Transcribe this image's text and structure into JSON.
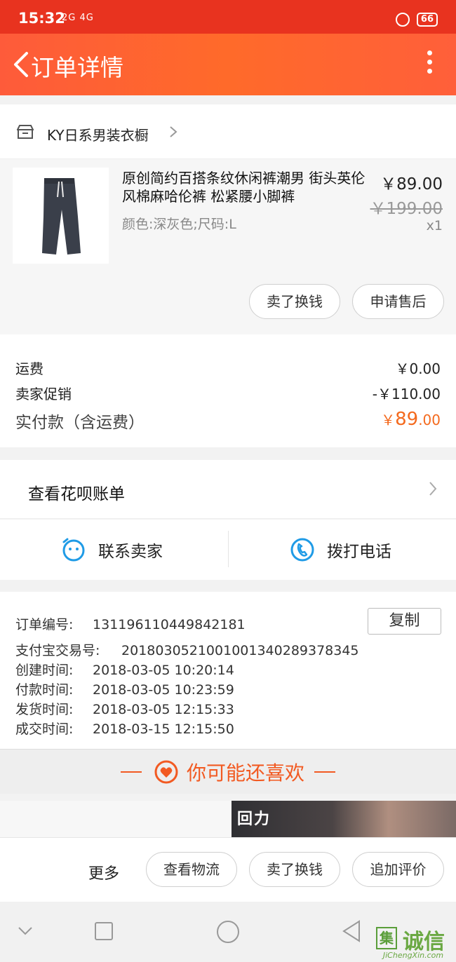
{
  "status_bar": {
    "time": "15:32",
    "signal": "2G 4G",
    "battery": "66"
  },
  "header": {
    "title": "订单详情"
  },
  "shop": {
    "name": "KY日系男装衣橱"
  },
  "item": {
    "title": "原创简约百搭条纹休闲裤潮男 街头英伦风棉麻哈伦裤 松紧腰小脚裤",
    "spec": "颜色:深灰色;尺码:L",
    "price": "￥89.00",
    "original_price": "￥199.00",
    "quantity": "x1",
    "buttons": [
      "卖了换钱",
      "申请售后"
    ]
  },
  "fees": {
    "shipping_label": "运费",
    "shipping_value": "￥0.00",
    "promo_label": "卖家促销",
    "promo_value": "-￥110.00",
    "total_label": "实付款（含运费）",
    "total_currency": "￥",
    "total_int": "89",
    "total_dec": ".00"
  },
  "huabei": {
    "label": "查看花呗账单"
  },
  "contact": {
    "seller": "联系卖家",
    "phone": "拨打电话"
  },
  "order_info": {
    "copy_label": "复制",
    "rows": [
      {
        "key": "订单编号:",
        "value": "131196110449842181"
      },
      {
        "key": "支付宝交易号:",
        "value": "2018030521001001340289378345"
      },
      {
        "key": "创建时间:",
        "value": "2018-03-05 10:20:14"
      },
      {
        "key": "付款时间:",
        "value": "2018-03-05 10:23:59"
      },
      {
        "key": "发货时间:",
        "value": "2018-03-05 12:15:33"
      },
      {
        "key": "成交时间:",
        "value": "2018-03-15 12:15:50"
      }
    ]
  },
  "recommend": {
    "title": "你可能还喜欢",
    "banner_logo": "回力"
  },
  "actions": {
    "more": "更多",
    "buttons": [
      "查看物流",
      "卖了换钱",
      "追加评价"
    ]
  },
  "watermark": {
    "box": "集",
    "text": "诚信",
    "url": "JiChengXin.com"
  },
  "colors": {
    "accent": "#ff5f3a",
    "price_orange": "#f46a1e",
    "rec_orange": "#f25a22"
  }
}
